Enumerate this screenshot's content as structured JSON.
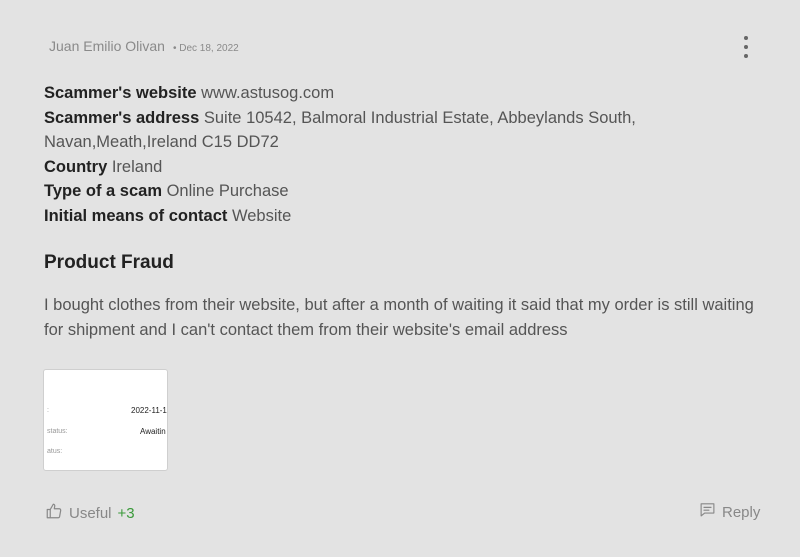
{
  "review": {
    "author": "Juan Emilio Olivan",
    "date": "• Dec 18, 2022",
    "details": [
      {
        "label": "Scammer's website",
        "value": "www.astusog.com"
      },
      {
        "label": "Scammer's address",
        "value": "Suite 10542, Balmoral Industrial Estate, Abbeylands South, Navan,Meath,Ireland C15 DD72"
      },
      {
        "label": "Country",
        "value": "Ireland"
      },
      {
        "label": "Type of a scam",
        "value": "Online Purchase"
      },
      {
        "label": "Initial means of contact",
        "value": "Website"
      }
    ],
    "title": "Product Fraud",
    "body": "I bought clothes from their website, but after a month of waiting it said that my order is still waiting for shipment and I can't contact them from their website's email address",
    "attachment": {
      "lines": [
        {
          "key": ":",
          "value": "2022-11-1:"
        },
        {
          "key": "status:",
          "value": "Awaitin"
        },
        {
          "key": "atus:",
          "value": ""
        }
      ]
    }
  },
  "footer": {
    "useful_label": "Useful",
    "useful_count": "+3",
    "reply_label": "Reply"
  }
}
